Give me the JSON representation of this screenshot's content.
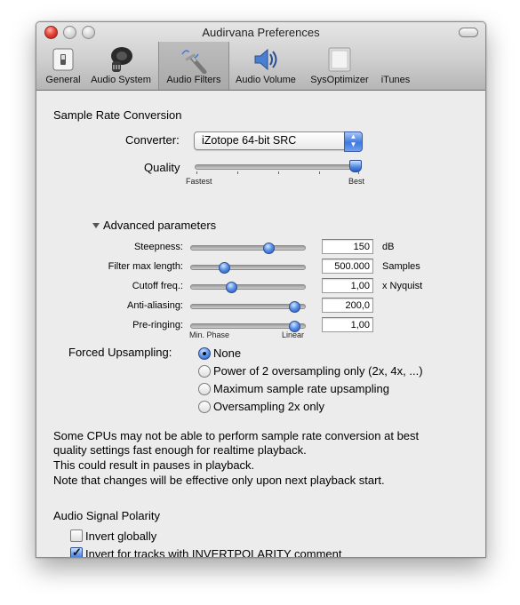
{
  "window": {
    "title": "Audirvana Preferences"
  },
  "toolbar": {
    "items": [
      {
        "label": "General",
        "icon": "switch-icon"
      },
      {
        "label": "Audio System",
        "icon": "speaker-icon"
      },
      {
        "label": "Audio Filters",
        "icon": "filter-icon",
        "selected": true
      },
      {
        "label": "Audio Volume",
        "icon": "volume-icon"
      },
      {
        "label": "SysOptimizer",
        "icon": "optimizer-icon"
      },
      {
        "label": "iTunes",
        "icon": "itunes-icon"
      }
    ]
  },
  "src": {
    "heading": "Sample Rate Conversion",
    "converter_label": "Converter:",
    "converter_value": "iZotope 64-bit SRC",
    "quality_label": "Quality",
    "quality_min": "Fastest",
    "quality_max": "Best",
    "quality_level": 1.0,
    "advanced_label": "Advanced parameters"
  },
  "params": [
    {
      "label": "Steepness:",
      "value": "150",
      "unit": "dB",
      "level": 0.7
    },
    {
      "label": "Filter max length:",
      "value": "500.000",
      "unit": "Samples",
      "level": 0.27
    },
    {
      "label": "Cutoff freq.:",
      "value": "1,00",
      "unit": "x Nyquist",
      "level": 0.34
    },
    {
      "label": "Anti-aliasing:",
      "value": "200,0",
      "unit": "",
      "level": 0.95
    },
    {
      "label": "Pre-ringing:",
      "value": "1,00",
      "unit": "",
      "level": 0.95
    }
  ],
  "prering_min": "Min. Phase",
  "prering_max": "Linear",
  "upsampling": {
    "label": "Forced  Upsampling:",
    "options": [
      {
        "label": "None",
        "selected": true
      },
      {
        "label": "Power of 2 oversampling only (2x, 4x, ...)",
        "selected": false
      },
      {
        "label": "Maximum sample rate upsampling",
        "selected": false
      },
      {
        "label": "Oversampling 2x only",
        "selected": false
      }
    ]
  },
  "note": {
    "line1": "Some CPUs may not be able to perform sample rate conversion at best",
    "line2": "quality settings fast enough for realtime playback.",
    "line3": "This could result in pauses in playback.",
    "line4": "Note that changes will be effective only upon next playback start."
  },
  "polarity": {
    "heading": "Audio Signal Polarity",
    "invert_globally": "Invert globally",
    "invert_globally_checked": false,
    "invert_tag": "Invert for tracks with INVERTPOLARITY comment",
    "invert_tag_checked": true
  },
  "colors": {
    "accent": "#3f78e0",
    "window_bg": "#ececec"
  }
}
